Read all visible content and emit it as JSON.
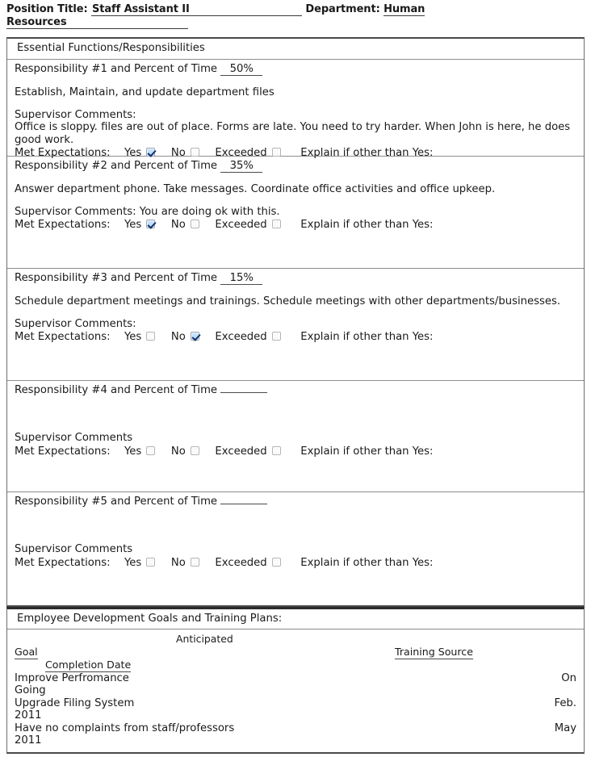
{
  "header": {
    "position_label": "Position Title:",
    "position_value": "Staff Assistant II",
    "department_label": "Department:",
    "department_value": "Human",
    "department_value_wrap": "Resources"
  },
  "responsibilities_table": {
    "section_header": "Essential Functions/Responsibilities",
    "items": [
      {
        "title_prefix": "Responsibility #1 and Percent of Time",
        "percent": "50%",
        "description": "Establish, Maintain, and update department files",
        "supervisor_label": "Supervisor Comments:",
        "supervisor_comment": "Office is sloppy. files are out of place. Forms are late. You need to try harder. When John is here, he does good work.",
        "met_label": "Met Expectations:",
        "yes_label": "Yes",
        "no_label": "No",
        "exceeded_label": "Exceeded",
        "explain_label": "Explain if other than Yes:",
        "yes_checked": true,
        "no_checked": false,
        "exceeded_checked": false
      },
      {
        "title_prefix": "Responsibility #2 and Percent of Time",
        "percent": "35%",
        "description": "Answer department phone. Take messages. Coordinate office activities and office upkeep.",
        "supervisor_label": "Supervisor Comments:",
        "supervisor_comment": "You are doing ok with this.",
        "met_label": "Met Expectations:",
        "yes_label": "Yes",
        "no_label": "No",
        "exceeded_label": "Exceeded",
        "explain_label": "Explain if other than Yes:",
        "yes_checked": true,
        "no_checked": false,
        "exceeded_checked": false
      },
      {
        "title_prefix": "Responsibility #3 and Percent of Time",
        "percent": "15%",
        "description": "Schedule department meetings and trainings. Schedule meetings with other departments/businesses.",
        "supervisor_label": "Supervisor Comments:",
        "supervisor_comment": "",
        "met_label": "Met Expectations:",
        "yes_label": "Yes",
        "no_label": "No",
        "exceeded_label": "Exceeded",
        "explain_label": "Explain if other than Yes:",
        "yes_checked": false,
        "no_checked": true,
        "exceeded_checked": false
      },
      {
        "title_prefix": "Responsibility #4 and Percent of Time",
        "percent": "",
        "description": "",
        "supervisor_label": "Supervisor Comments",
        "supervisor_comment": "",
        "met_label": "Met Expectations:",
        "yes_label": "Yes",
        "no_label": "No",
        "exceeded_label": "Exceeded",
        "explain_label": "Explain if other than Yes:",
        "yes_checked": false,
        "no_checked": false,
        "exceeded_checked": false
      },
      {
        "title_prefix": "Responsibility #5 and Percent of Time",
        "percent": "",
        "description": "",
        "supervisor_label": "Supervisor Comments",
        "supervisor_comment": "",
        "met_label": "Met Expectations:",
        "yes_label": "Yes",
        "no_label": "No",
        "exceeded_label": "Exceeded",
        "explain_label": "Explain if other than Yes:",
        "yes_checked": false,
        "no_checked": false,
        "exceeded_checked": false
      }
    ]
  },
  "goals_table": {
    "section_header": "Employee Development Goals and Training Plans:",
    "anticipated_label": "Anticipated",
    "col_goal": "Goal",
    "col_completion_date": "Completion Date",
    "col_training_source": "Training Source",
    "rows": [
      {
        "goal": "Improve Perfromance",
        "date_line1": "On",
        "date_line2": "Going"
      },
      {
        "goal": "Upgrade Filing System",
        "date_line1": "Feb.",
        "date_line2": "2011"
      },
      {
        "goal": "Have no complaints from staff/professors",
        "date_line1": "May",
        "date_line2": "2011"
      }
    ]
  }
}
